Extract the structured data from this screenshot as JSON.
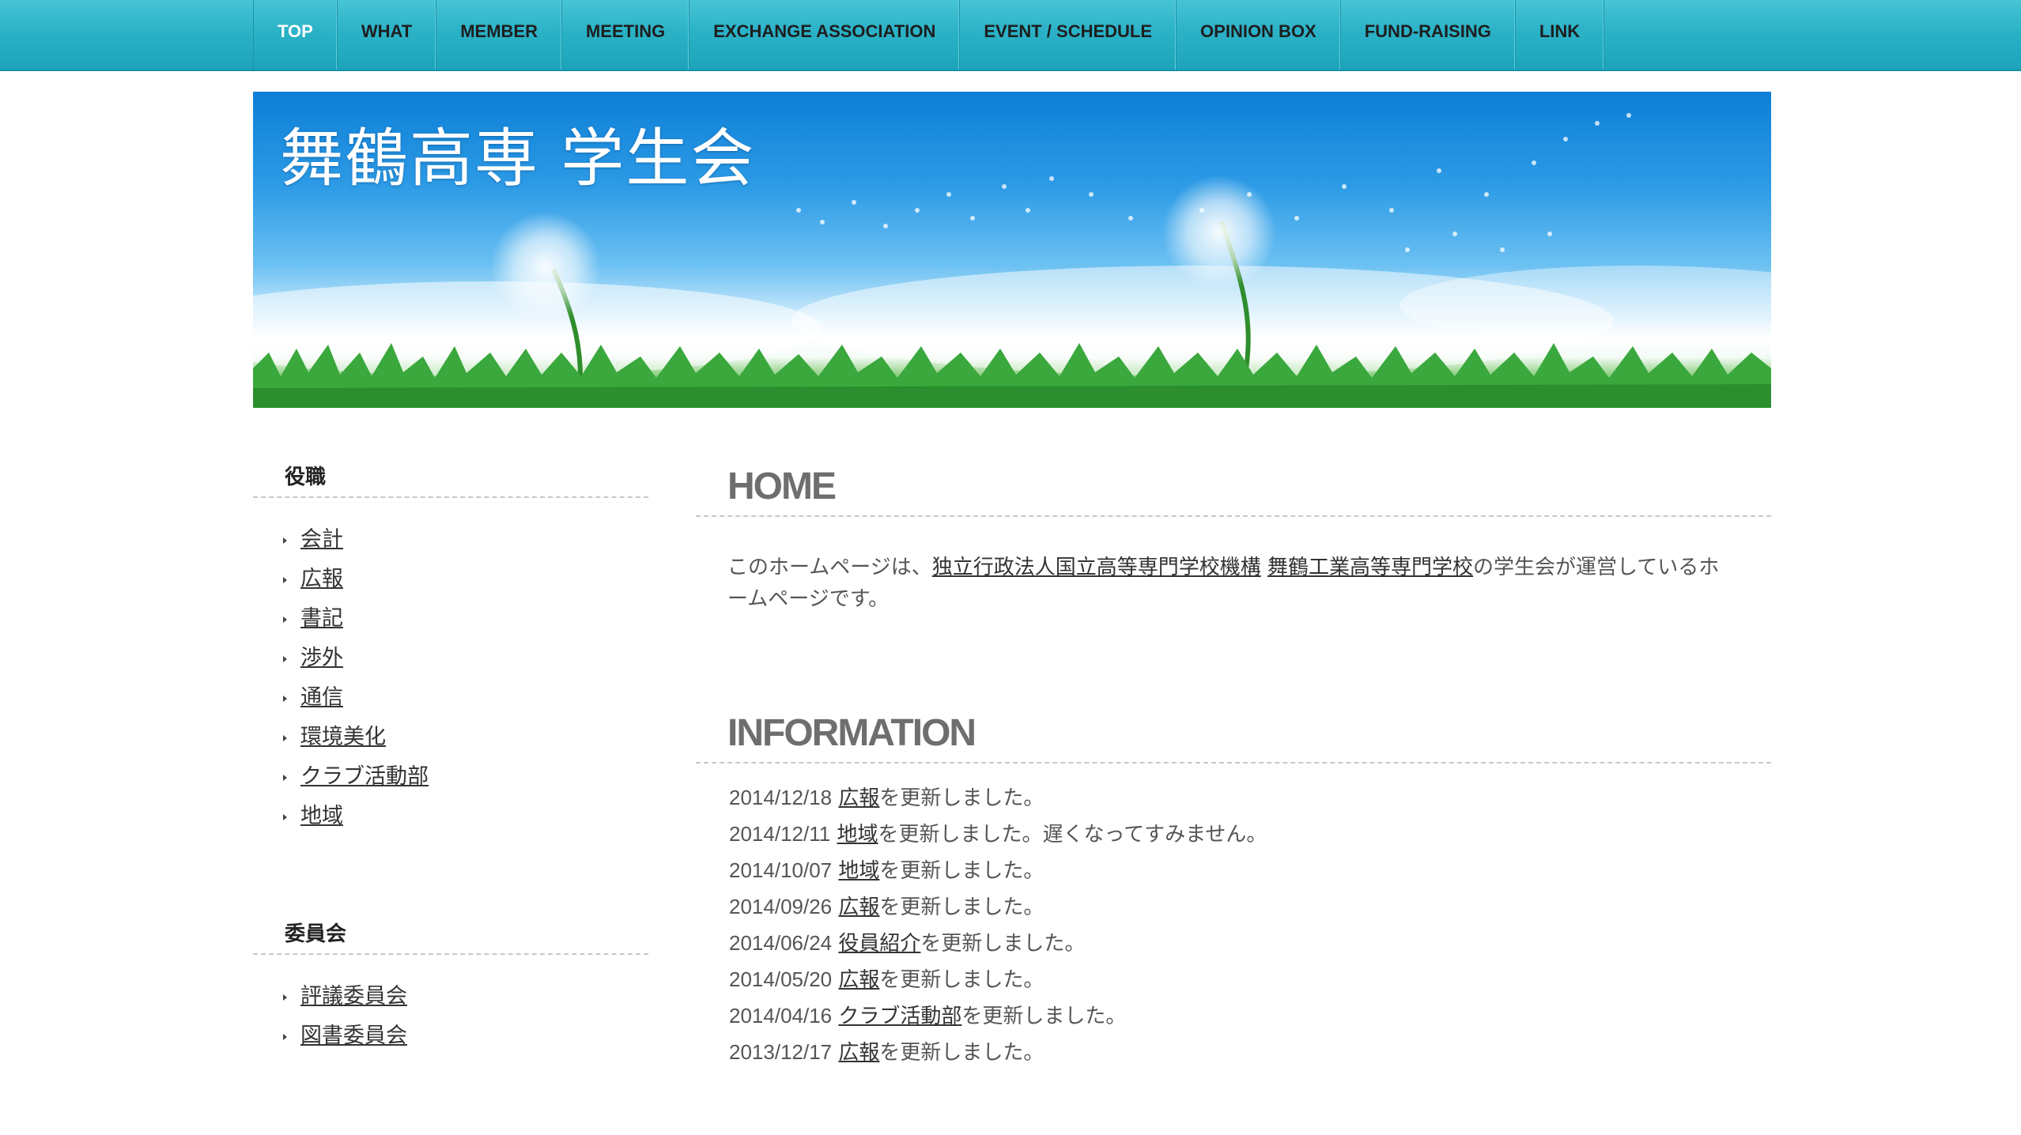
{
  "nav": {
    "items": [
      {
        "label": "TOP"
      },
      {
        "label": "WHAT"
      },
      {
        "label": "MEMBER"
      },
      {
        "label": "MEETING"
      },
      {
        "label": "EXCHANGE ASSOCIATION"
      },
      {
        "label": "EVENT / SCHEDULE"
      },
      {
        "label": "OPINION BOX"
      },
      {
        "label": "FUND-RAISING"
      },
      {
        "label": "LINK"
      }
    ]
  },
  "banner": {
    "title": "舞鶴高専 学生会"
  },
  "sidebar": {
    "sections": [
      {
        "heading": "役職",
        "items": [
          "会計",
          "広報",
          "書記",
          "渉外",
          "通信",
          "環境美化",
          "クラブ活動部",
          "地域"
        ]
      },
      {
        "heading": "委員会",
        "items": [
          "評議委員会",
          "図書委員会"
        ]
      }
    ]
  },
  "main": {
    "home_heading": "HOME",
    "intro": {
      "prefix": "このホームページは、",
      "link1": "独立行政法人国立高等専門学校機構",
      "space": " ",
      "link2": "舞鶴工業高等専門学校",
      "suffix": "の学生会が運営しているホームページです。"
    },
    "info_heading": "INFORMATION",
    "info": [
      {
        "date": "2014/12/18",
        "link": "広報",
        "text": "を更新しました。"
      },
      {
        "date": "2014/12/11",
        "link": "地域",
        "text": "を更新しました。遅くなってすみません。"
      },
      {
        "date": "2014/10/07",
        "link": "地域",
        "text": "を更新しました。"
      },
      {
        "date": "2014/09/26",
        "link": "広報",
        "text": "を更新しました。"
      },
      {
        "date": "2014/06/24",
        "link": "役員紹介",
        "text": "を更新しました。"
      },
      {
        "date": "2014/05/20",
        "link": "広報",
        "text": "を更新しました。"
      },
      {
        "date": "2014/04/16",
        "link": "クラブ活動部",
        "text": "を更新しました。"
      },
      {
        "date": "2013/12/17",
        "link": "広報",
        "text": "を更新しました。"
      }
    ]
  }
}
